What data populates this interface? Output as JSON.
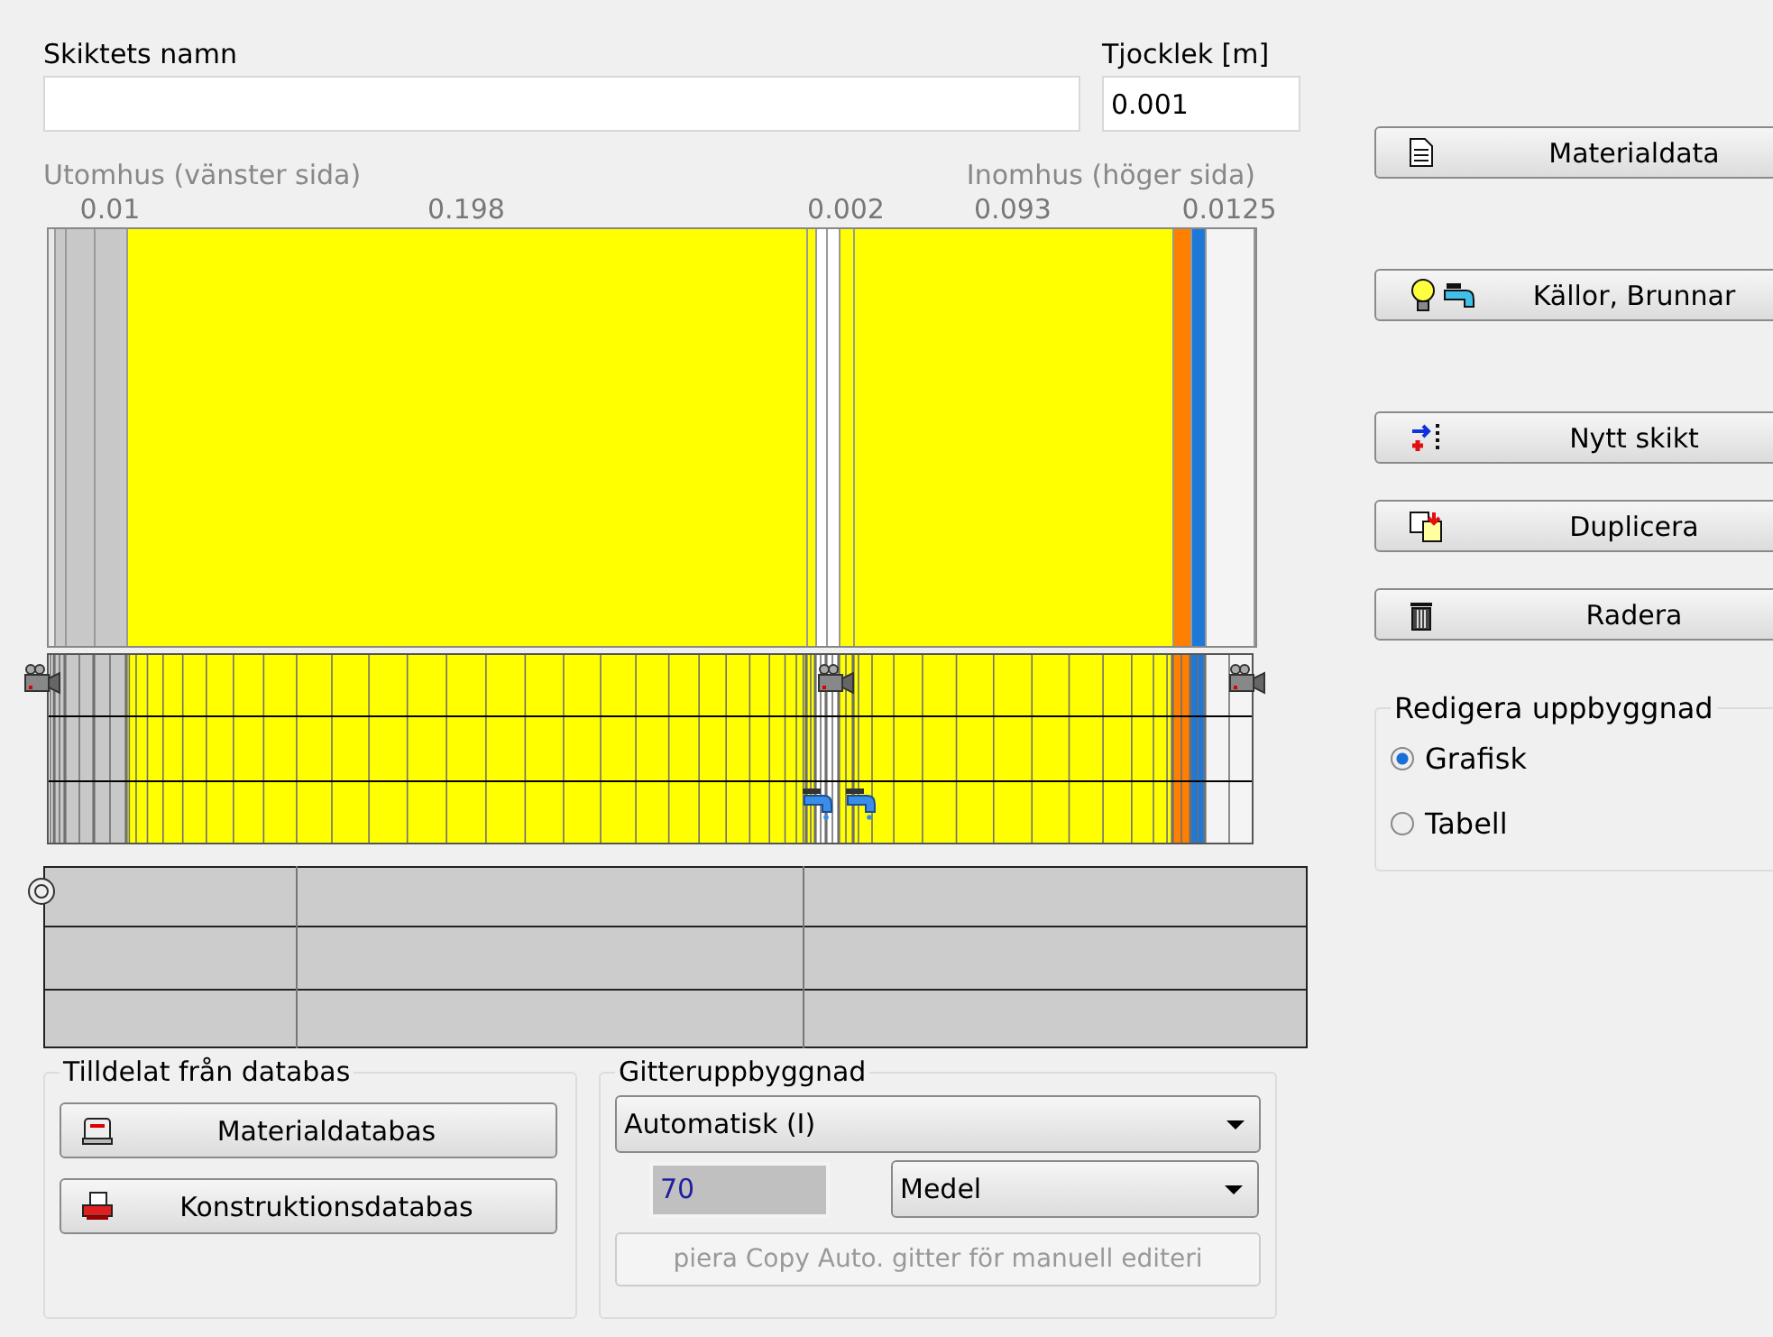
{
  "name_field": {
    "label": "Skiktets namn"
  },
  "thickness_field": {
    "label": "Tjocklek [m]",
    "value": "0.001"
  },
  "side_labels": {
    "outdoor": "Utomhus (vänster sida)",
    "indoor": "Inomhus (höger sida)"
  },
  "layers": [
    {
      "color": "#e8e8e8"
    },
    {
      "color": "#c8c8c8"
    },
    {
      "color": "#c8c8c8"
    },
    {
      "color": "#c8c8c8",
      "label": "0.01"
    },
    {
      "color": "#ffff00",
      "label": "0.198"
    },
    {
      "color": "#ffff00"
    },
    {
      "color": "#ffffff"
    },
    {
      "color": "#ffffff"
    },
    {
      "color": "#ffff00",
      "label": "0.002"
    },
    {
      "color": "#ffff00",
      "label": "0.093"
    },
    {
      "color": "#ff8000"
    },
    {
      "color": "#1e78d8"
    },
    {
      "color": "#f4f4f4",
      "label": "0.0125"
    }
  ],
  "buttons": [
    {
      "label": "Materialdata",
      "kind": "document"
    },
    {
      "label": "Källor, Brunnar",
      "kind": "sources"
    },
    {
      "label": "Nytt skikt",
      "kind": "new-layer"
    },
    {
      "label": "Duplicera",
      "kind": "duplicate"
    },
    {
      "label": "Radera",
      "kind": "delete"
    }
  ],
  "edit_mode": {
    "title": "Redigera uppbyggnad",
    "options": [
      {
        "label": "Grafisk",
        "selected": true
      },
      {
        "label": "Tabell",
        "selected": false
      }
    ]
  },
  "database": {
    "title": "Tilldelat från databas",
    "buttons": [
      {
        "label": "Materialdatabas",
        "kind": "material"
      },
      {
        "label": "Konstruktionsdatabas",
        "kind": "construction"
      }
    ]
  },
  "grid": {
    "title": "Gitteruppbyggnad",
    "mode": "Automatisk (I)",
    "count": "70",
    "density": "Medel",
    "copy_button": {
      "label": "piera Copy Auto. gitter för manuell editeri",
      "disabled": true
    }
  }
}
